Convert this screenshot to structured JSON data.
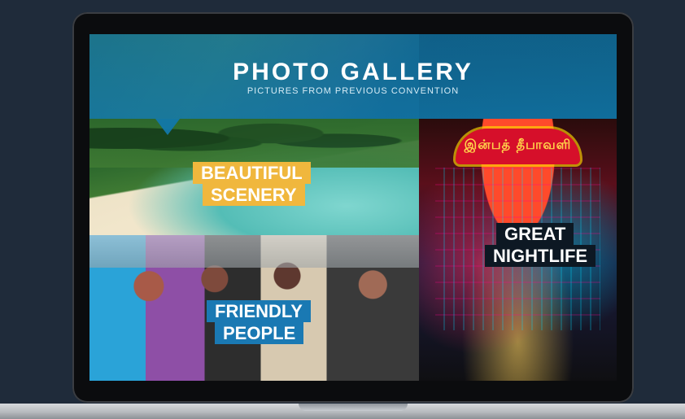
{
  "header": {
    "title": "PHOTO GALLERY",
    "subtitle": "PICTURES FROM PREVIOUS CONVENTION"
  },
  "tiles": {
    "scenery": {
      "line1": "BEAUTIFUL",
      "line2": "SCENERY"
    },
    "nightlife": {
      "line1": "GREAT",
      "line2": "NIGHTLIFE",
      "sign_text": "இன்பத் தீபாவளி"
    },
    "people": {
      "line1": "FRIENDLY",
      "line2": "PEOPLE"
    }
  },
  "colors": {
    "header_blue": "#1278aa",
    "label_yellow": "#f0b73d",
    "label_dark": "#0d1823",
    "label_blue": "#1a79b3",
    "page_background": "#1f2b3a"
  }
}
